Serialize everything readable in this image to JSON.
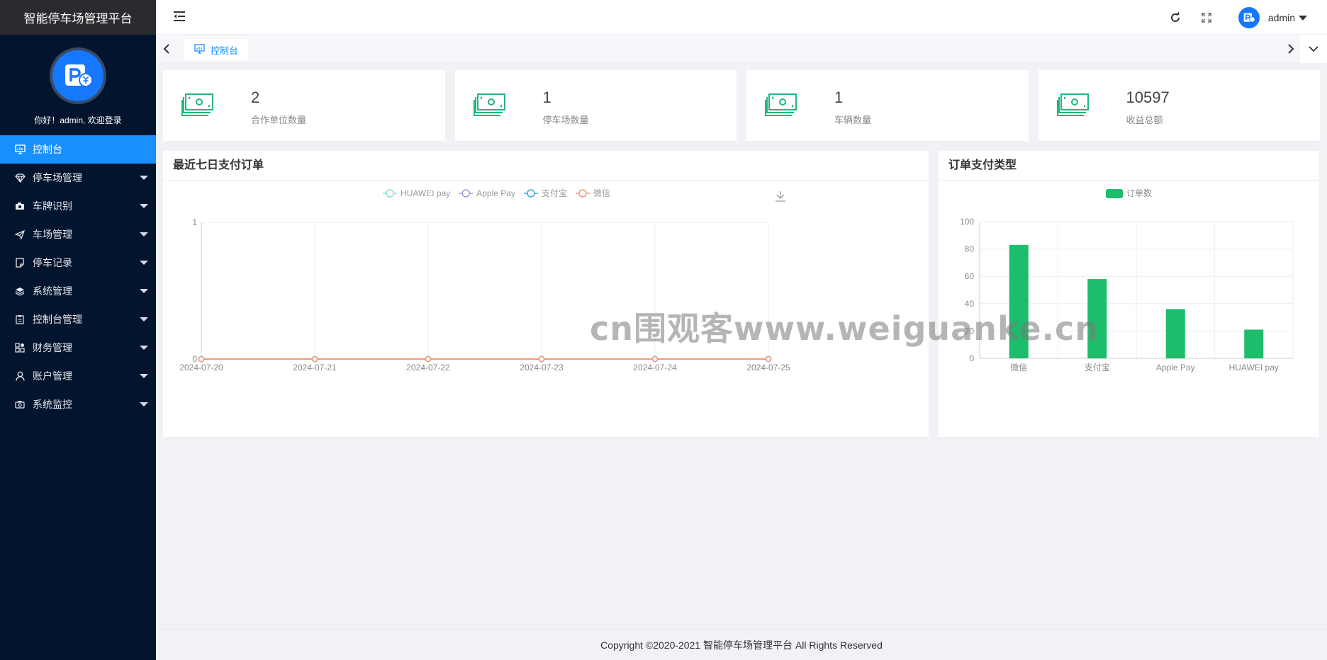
{
  "app": {
    "title": "智能停车场管理平台"
  },
  "sidebar": {
    "welcome": "你好！admin, 欢迎登录",
    "items": [
      {
        "label": "控制台",
        "icon": "monitor-icon",
        "active": true
      },
      {
        "label": "停车场管理",
        "icon": "diamond-icon"
      },
      {
        "label": "车牌识别",
        "icon": "camera-icon"
      },
      {
        "label": "车场管理",
        "icon": "send-icon"
      },
      {
        "label": "停车记录",
        "icon": "note-icon"
      },
      {
        "label": "系统管理",
        "icon": "layers-icon"
      },
      {
        "label": "控制台管理",
        "icon": "clipboard-icon"
      },
      {
        "label": "财务管理",
        "icon": "apps-icon"
      },
      {
        "label": "账户管理",
        "icon": "user-icon"
      },
      {
        "label": "系统监控",
        "icon": "camera-icon"
      }
    ]
  },
  "header": {
    "username": "admin"
  },
  "tabs": [
    {
      "label": "控制台",
      "icon": "monitor-icon"
    }
  ],
  "stats": [
    {
      "value": "2",
      "label": "合作单位数量",
      "icon": "money-icon"
    },
    {
      "value": "1",
      "label": "停车场数量",
      "icon": "money-icon"
    },
    {
      "value": "1",
      "label": "车辆数量",
      "icon": "money-icon"
    },
    {
      "value": "10597",
      "label": "收益总额",
      "icon": "money-icon"
    }
  ],
  "panels": {
    "line_title": "最近七日支付订单",
    "bar_title": "订单支付类型"
  },
  "colors": {
    "sidebar_bg": "#03152e",
    "accent": "#1890ff",
    "stat_icon": "#1fb87a",
    "bar": "#1dbd6b"
  },
  "chart_data": [
    {
      "type": "line",
      "title": "",
      "x": [
        "2024-07-20",
        "2024-07-21",
        "2024-07-22",
        "2024-07-23",
        "2024-07-24",
        "2024-07-25"
      ],
      "series": [
        {
          "name": "HUAWEI pay",
          "values": [
            0,
            0,
            0,
            0,
            0,
            0
          ],
          "color": "#91e3c4"
        },
        {
          "name": "Apple Pay",
          "values": [
            0,
            0,
            0,
            0,
            0,
            0
          ],
          "color": "#a99bd8"
        },
        {
          "name": "支付宝",
          "values": [
            0,
            0,
            0,
            0,
            0,
            0
          ],
          "color": "#3fa7d6"
        },
        {
          "name": "微信",
          "values": [
            0,
            0,
            0,
            0,
            0,
            0
          ],
          "color": "#f0977a"
        }
      ],
      "ylim": [
        0,
        1
      ],
      "yticks": [
        "0",
        "1"
      ],
      "legend": "top-center",
      "grid": true
    },
    {
      "type": "bar",
      "title": "",
      "categories": [
        "微信",
        "支付宝",
        "Apple Pay",
        "HUAWEI pay"
      ],
      "series": [
        {
          "name": "订单数",
          "values": [
            83,
            58,
            36,
            21
          ]
        }
      ],
      "ylim": [
        0,
        100
      ],
      "yticks": [
        "0",
        "20",
        "40",
        "60",
        "80",
        "100"
      ],
      "legend": "top-center",
      "grid": true
    }
  ],
  "footer": {
    "copyright": "Copyright ©2020-2021 智能停车场管理平台 All Rights Reserved"
  },
  "watermark": "cn围观客www.weiguanke.cn"
}
